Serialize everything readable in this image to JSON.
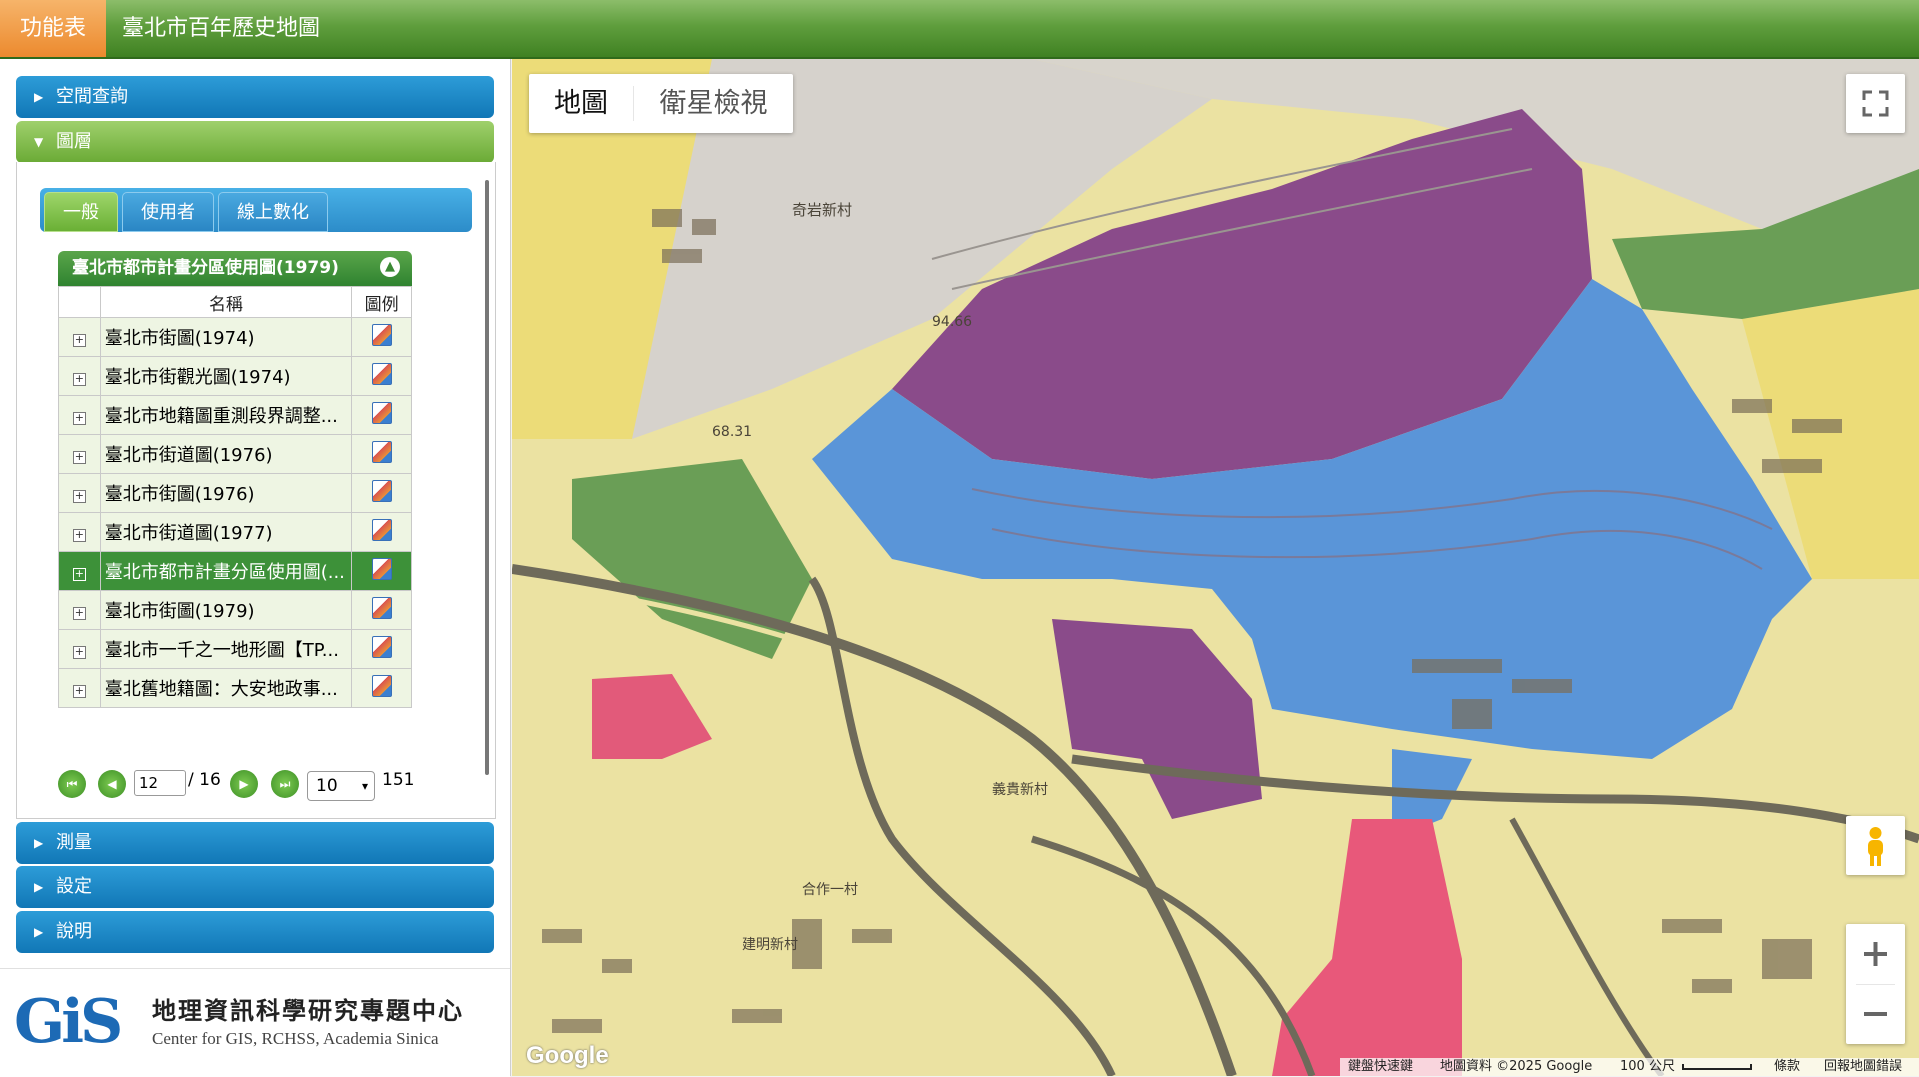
{
  "header": {
    "menu_label": "功能表",
    "title": "臺北市百年歷史地圖"
  },
  "accordion": {
    "spatial_query": "空間查詢",
    "layers": "圖層",
    "measure": "測量",
    "settings": "設定",
    "help": "說明"
  },
  "tabs": [
    {
      "label": "一般"
    },
    {
      "label": "使用者"
    },
    {
      "label": "線上數化"
    }
  ],
  "layer_table": {
    "title": "臺北市都市計畫分區使用圖(1979)",
    "col_name": "名稱",
    "col_legend": "圖例",
    "rows": [
      {
        "name": "臺北市街圖(1974)"
      },
      {
        "name": "臺北市街觀光圖(1974)"
      },
      {
        "name": "臺北市地籍圖重測段界調整..."
      },
      {
        "name": "臺北市街道圖(1976)"
      },
      {
        "name": "臺北市街圖(1976)"
      },
      {
        "name": "臺北市街道圖(1977)"
      },
      {
        "name": "臺北市都市計畫分區使用圖(..."
      },
      {
        "name": "臺北市街圖(1979)"
      },
      {
        "name": "臺北市一千之一地形圖【TP..."
      },
      {
        "name": "臺北舊地籍圖：大安地政事..."
      }
    ],
    "selected_row": 7
  },
  "pager": {
    "current_page": "12",
    "total_pages": "/ 16",
    "page_size": "10",
    "total_count": "151"
  },
  "logo": {
    "org_cn": "地理資訊科學研究專題中心",
    "org_en": "Center for GIS, RCHSS, Academia Sinica",
    "logo_text": "GiS"
  },
  "map": {
    "type_map": "地圖",
    "type_satellite": "衛星檢視",
    "attribution": {
      "shortcuts": "鍵盤快速鍵",
      "data": "地圖資料 ©2025 Google",
      "scale": "100 公尺",
      "terms": "條款",
      "report": "回報地圖錯誤"
    },
    "map_labels": {
      "village1": "奇岩新村",
      "elev1": "94.66",
      "elev2": "68.31",
      "village2": "義貴新村",
      "village3": "合作一村",
      "village4": "建明新村"
    },
    "google_label": "Google"
  },
  "colors": {
    "header_green": "#4f8f2e",
    "menu_orange": "#ec8a2e",
    "accordion_blue": "#1a87c6",
    "selected_row": "#3d9139"
  }
}
